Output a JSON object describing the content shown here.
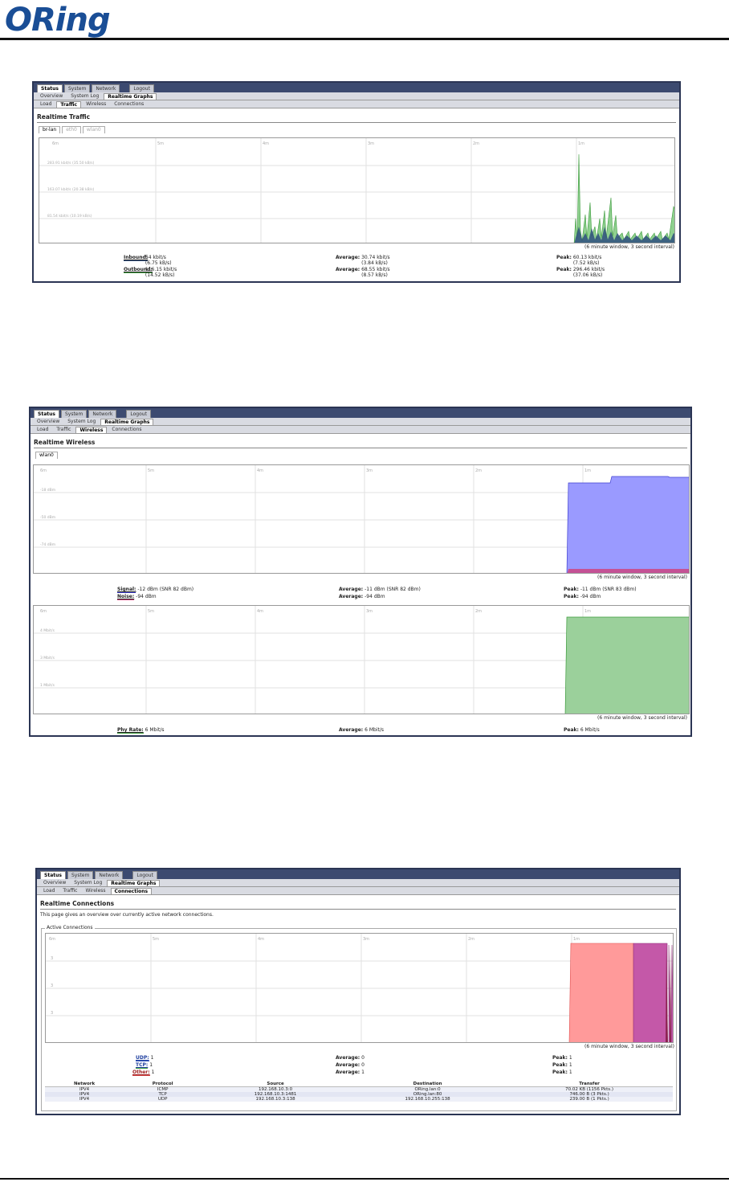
{
  "header": {
    "brand": "ORing"
  },
  "nav": {
    "tabs": [
      "Status",
      "System",
      "Network",
      "Logout"
    ],
    "subtabs": [
      "Overview",
      "System Log",
      "Realtime Graphs"
    ],
    "graphtabs": [
      "Load",
      "Traffic",
      "Wireless",
      "Connections"
    ]
  },
  "window_caption": "(6 minute window, 3 second interval)",
  "traffic": {
    "title": "Realtime Traffic",
    "interfaces": [
      "br-lan",
      "eth0",
      "wlan0"
    ],
    "time_labels": [
      "6m",
      "5m",
      "4m",
      "3m",
      "2m",
      "1m"
    ],
    "y_labels": [
      "283.91 kbit/s (35.50 kB/s)",
      "163.07 kbit/s (20.38 kB/s)",
      "81.54 kbit/s (10.19 kB/s)"
    ],
    "inbound": {
      "label": "Inbound:",
      "current": "54 kbit/s",
      "current_b": "(6.75 kB/s)",
      "avg_label": "Average:",
      "avg": "30.74 kbit/s",
      "avg_b": "(3.84 kB/s)",
      "peak_label": "Peak:",
      "peak": "60.13 kbit/s",
      "peak_b": "(7.52 kB/s)"
    },
    "outbound": {
      "label": "Outbound:",
      "current": "116.15 kbit/s",
      "current_b": "(14.52 kB/s)",
      "avg_label": "Average:",
      "avg": "68.55 kbit/s",
      "avg_b": "(8.57 kB/s)",
      "peak_label": "Peak:",
      "peak": "296.46 kbit/s",
      "peak_b": "(37.06 kB/s)"
    }
  },
  "wireless": {
    "title": "Realtime Wireless",
    "interfaces": [
      "wlan0"
    ],
    "time_labels": [
      "6m",
      "5m",
      "4m",
      "3m",
      "2m",
      "1m"
    ],
    "y_labels": [
      "-18 dBm",
      "-50 dBm",
      "-74 dBm"
    ],
    "rate_y_labels": [
      "4 Mbit/s",
      "3 Mbit/s",
      "1 Mbit/s"
    ],
    "signal": {
      "label": "Signal:",
      "current": "-12 dBm (SNR 82 dBm)",
      "avg_label": "Average:",
      "avg": "-11 dBm (SNR 82 dBm)",
      "peak_label": "Peak:",
      "peak": "-11 dBm (SNR 83 dBm)"
    },
    "noise": {
      "label": "Noise:",
      "current": "-94 dBm",
      "avg_label": "Average:",
      "avg": "-94 dBm",
      "peak_label": "Peak:",
      "peak": "-94 dBm"
    },
    "phyrate": {
      "label": "Phy Rate:",
      "current": "6 Mbit/s",
      "avg_label": "Average:",
      "avg": "6 Mbit/s",
      "peak_label": "Peak:",
      "peak": "6 Mbit/s"
    }
  },
  "connections": {
    "title": "Realtime Connections",
    "description": "This page gives an overview over currently active network connections.",
    "legend": "Active Connections",
    "time_labels": [
      "6m",
      "5m",
      "4m",
      "3m",
      "2m",
      "1m"
    ],
    "y_labels": [
      "3",
      "3",
      "3"
    ],
    "udp": {
      "label": "UDP:",
      "current": "1",
      "avg_label": "Average:",
      "avg": "0",
      "peak_label": "Peak:",
      "peak": "1"
    },
    "tcp": {
      "label": "TCP:",
      "current": "1",
      "avg_label": "Average:",
      "avg": "0",
      "peak_label": "Peak:",
      "peak": "1"
    },
    "other": {
      "label": "Other:",
      "current": "1",
      "avg_label": "Average:",
      "avg": "1",
      "peak_label": "Peak:",
      "peak": "1"
    },
    "columns": [
      "Network",
      "Protocol",
      "Source",
      "Destination",
      "Transfer"
    ],
    "rows": [
      [
        "IPV4",
        "ICMP",
        "192.168.10.3:0",
        "ORing.lan:0",
        "70.02 KB (1156 Pkts.)"
      ],
      [
        "IPV4",
        "TCP",
        "192.168.10.3:1481",
        "ORing.lan:80",
        "746.00 B (3 Pkts.)"
      ],
      [
        "IPV4",
        "UDP",
        "192.168.10.3:138",
        "192.168.10.255:138",
        "239.00 B (1 Pkts.)"
      ]
    ]
  },
  "colors": {
    "nav": "#3c4a70",
    "inbound": "#2f4f7f",
    "outbound": "#5fbf5f",
    "signal": "#8080ff",
    "noise": "#d0407a",
    "phy": "#8fcc8f",
    "udp": "#ff9090",
    "tcp": "#c050a0"
  }
}
